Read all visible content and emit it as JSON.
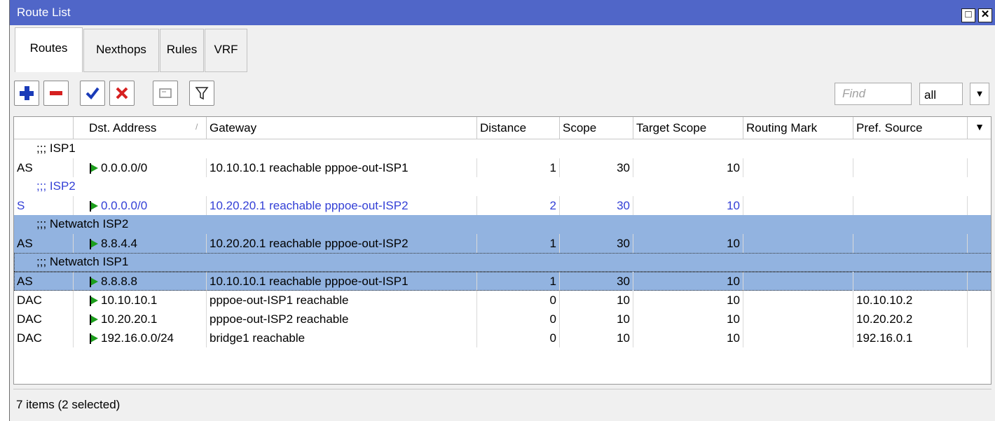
{
  "window": {
    "title": "Route List",
    "controls": [
      {
        "name": "maximize-button",
        "glyph": "□"
      },
      {
        "name": "close-button",
        "glyph": "✕"
      }
    ]
  },
  "tabs": [
    {
      "label": "Routes",
      "active": true
    },
    {
      "label": "Nexthops",
      "active": false
    },
    {
      "label": "Rules",
      "active": false
    },
    {
      "label": "VRF",
      "active": false
    }
  ],
  "toolbar": {
    "buttons": [
      "add-icon",
      "remove-icon",
      "enable-icon",
      "disable-icon",
      "comment-icon",
      "filter-icon"
    ],
    "find_placeholder": "Find",
    "filter_value": "all",
    "filter_dropdown_glyph": "▼"
  },
  "table": {
    "columns": [
      "",
      "Dst. Address",
      "Gateway",
      "Distance",
      "Scope",
      "Target Scope",
      "Routing Mark",
      "Pref. Source"
    ],
    "column_menu_glyph": "▼",
    "sort_indicator": "/",
    "rows": [
      {
        "comment": ";;; ISP1",
        "selected": false
      },
      {
        "flags": "AS",
        "dst": "0.0.0.0/0",
        "gateway": "10.10.10.1 reachable pppoe-out-ISP1",
        "distance": "1",
        "scope": "30",
        "target_scope": "10",
        "routing_mark": "",
        "pref_source": "",
        "selected": false,
        "style": "normal"
      },
      {
        "comment": ";;; ISP2",
        "selected": false,
        "style": "blue"
      },
      {
        "flags": "S",
        "dst": "0.0.0.0/0",
        "gateway": "10.20.20.1 reachable pppoe-out-ISP2",
        "distance": "2",
        "scope": "30",
        "target_scope": "10",
        "routing_mark": "",
        "pref_source": "",
        "selected": false,
        "style": "blue"
      },
      {
        "comment": ";;; Netwatch ISP2",
        "selected": true
      },
      {
        "flags": "AS",
        "dst": "8.8.4.4",
        "gateway": "10.20.20.1 reachable pppoe-out-ISP2",
        "distance": "1",
        "scope": "30",
        "target_scope": "10",
        "routing_mark": "",
        "pref_source": "",
        "selected": true,
        "style": "normal"
      },
      {
        "comment": ";;; Netwatch ISP1",
        "selected": true
      },
      {
        "flags": "AS",
        "dst": "8.8.8.8",
        "gateway": "10.10.10.1 reachable pppoe-out-ISP1",
        "distance": "1",
        "scope": "30",
        "target_scope": "10",
        "routing_mark": "",
        "pref_source": "",
        "selected": true,
        "style": "normal"
      },
      {
        "flags": "DAC",
        "dst": "10.10.10.1",
        "gateway": "pppoe-out-ISP1 reachable",
        "distance": "0",
        "scope": "10",
        "target_scope": "10",
        "routing_mark": "",
        "pref_source": "10.10.10.2",
        "selected": false,
        "style": "normal"
      },
      {
        "flags": "DAC",
        "dst": "10.20.20.1",
        "gateway": "pppoe-out-ISP2 reachable",
        "distance": "0",
        "scope": "10",
        "target_scope": "10",
        "routing_mark": "",
        "pref_source": "10.20.20.2",
        "selected": false,
        "style": "normal"
      },
      {
        "flags": "DAC",
        "dst": "192.16.0.0/24",
        "gateway": "bridge1 reachable",
        "distance": "0",
        "scope": "10",
        "target_scope": "10",
        "routing_mark": "",
        "pref_source": "192.16.0.1",
        "selected": false,
        "style": "normal"
      }
    ]
  },
  "status": {
    "text": "7 items (2 selected)"
  },
  "colors": {
    "titlebar": "#5066c8",
    "selection": "#92b3e0",
    "blue_text": "#3440d6",
    "flag": "#1c9e1c"
  }
}
